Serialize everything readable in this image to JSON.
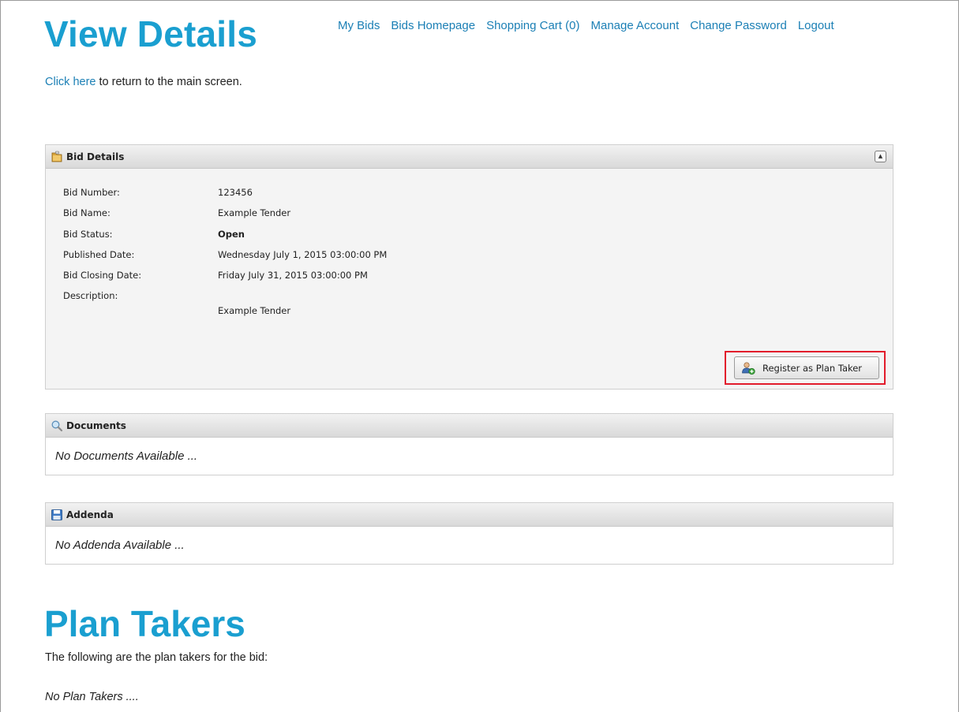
{
  "header": {
    "title": "View Details",
    "nav": [
      {
        "label": "My Bids"
      },
      {
        "label": "Bids Homepage"
      },
      {
        "label": "Shopping Cart (0)"
      },
      {
        "label": "Manage Account"
      },
      {
        "label": "Change Password"
      },
      {
        "label": "Logout"
      }
    ]
  },
  "return_line": {
    "link_text": "Click here",
    "rest_text": " to return to the main screen."
  },
  "bid_details": {
    "heading": "Bid Details",
    "fields": [
      {
        "label": "Bid Number:",
        "value": "123456"
      },
      {
        "label": "Bid Name:",
        "value": "Example Tender"
      },
      {
        "label": "Bid Status:",
        "value": "Open"
      },
      {
        "label": "Published Date:",
        "value": "Wednesday July 1, 2015 03:00:00 PM"
      },
      {
        "label": "Bid Closing Date:",
        "value": "Friday July 31, 2015 03:00:00 PM"
      },
      {
        "label": "Description:",
        "value": "Example Tender"
      }
    ],
    "register_button": "Register as Plan Taker",
    "icons": {
      "header": "folder-icon",
      "collapse": "collapse-up-icon",
      "button": "user-add-icon"
    }
  },
  "documents": {
    "heading": "Documents",
    "empty": "No Documents Available ...",
    "icon": "search-icon"
  },
  "addenda": {
    "heading": "Addenda",
    "empty": "No Addenda Available ...",
    "icon": "disk-icon"
  },
  "plan_takers": {
    "title": "Plan Takers",
    "intro": "The following are the plan takers for the bid:",
    "empty": "No Plan Takers ...."
  },
  "colors": {
    "title": "#1a9fd0",
    "link": "#1b7fb5",
    "highlight": "#e21b2b"
  }
}
